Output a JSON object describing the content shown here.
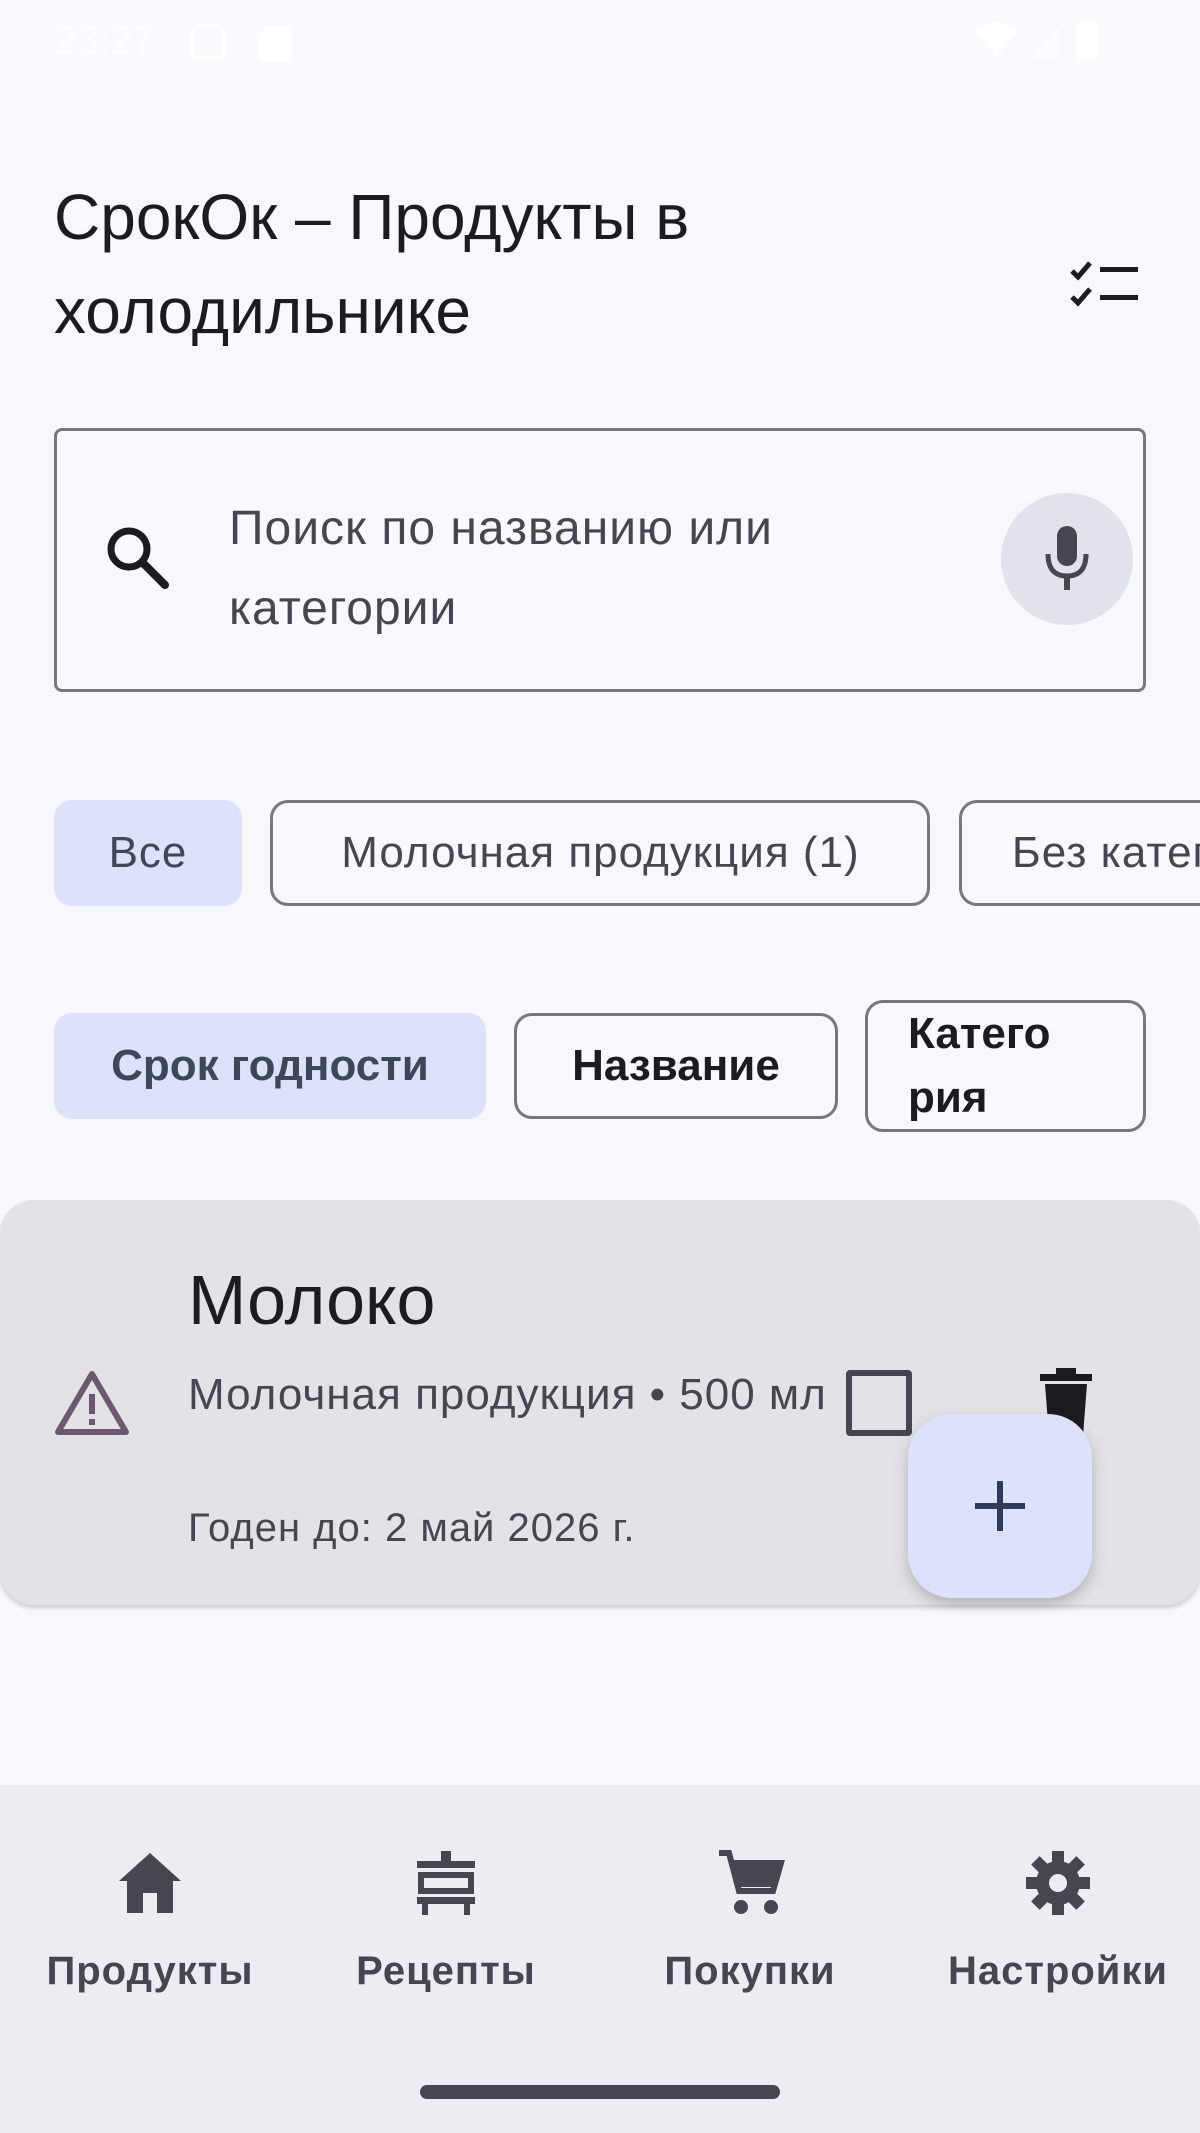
{
  "status_bar": {
    "time": "23:27"
  },
  "header": {
    "title": "СрокОк – Продукты в холодильнике",
    "checklist_icon": "checklist-icon"
  },
  "search": {
    "placeholder": "Поиск по названию или категории",
    "search_icon": "search-icon",
    "mic_icon": "mic-icon"
  },
  "category_chips": [
    {
      "label": "Все",
      "selected": true
    },
    {
      "label": "Молочная продукция (1)",
      "selected": false
    },
    {
      "label": "Без категории",
      "selected": false
    }
  ],
  "sort_chips": [
    {
      "label": "Срок годности",
      "selected": true
    },
    {
      "label": "Название",
      "selected": false
    },
    {
      "label": "Катего рия",
      "selected": false
    }
  ],
  "products": [
    {
      "name": "Молоко",
      "meta": "Молочная продукция • 500 мл",
      "expiry": "Годен до: 2 май 2026 г.",
      "status_icon": "warning-icon",
      "checked": false
    }
  ],
  "fab": {
    "icon": "plus-icon"
  },
  "bottom_nav": [
    {
      "label": "Продукты",
      "icon": "home-icon",
      "active": true
    },
    {
      "label": "Рецепты",
      "icon": "recipes-icon",
      "active": false
    },
    {
      "label": "Покупки",
      "icon": "cart-icon",
      "active": false
    },
    {
      "label": "Настройки",
      "icon": "gear-icon",
      "active": false
    }
  ],
  "colors": {
    "background": "#F8F8FD",
    "chip_selected": "#DCE2F9",
    "card": "#E3E2E7",
    "nav_background": "#ECECF3",
    "warning": "#6E5870"
  }
}
